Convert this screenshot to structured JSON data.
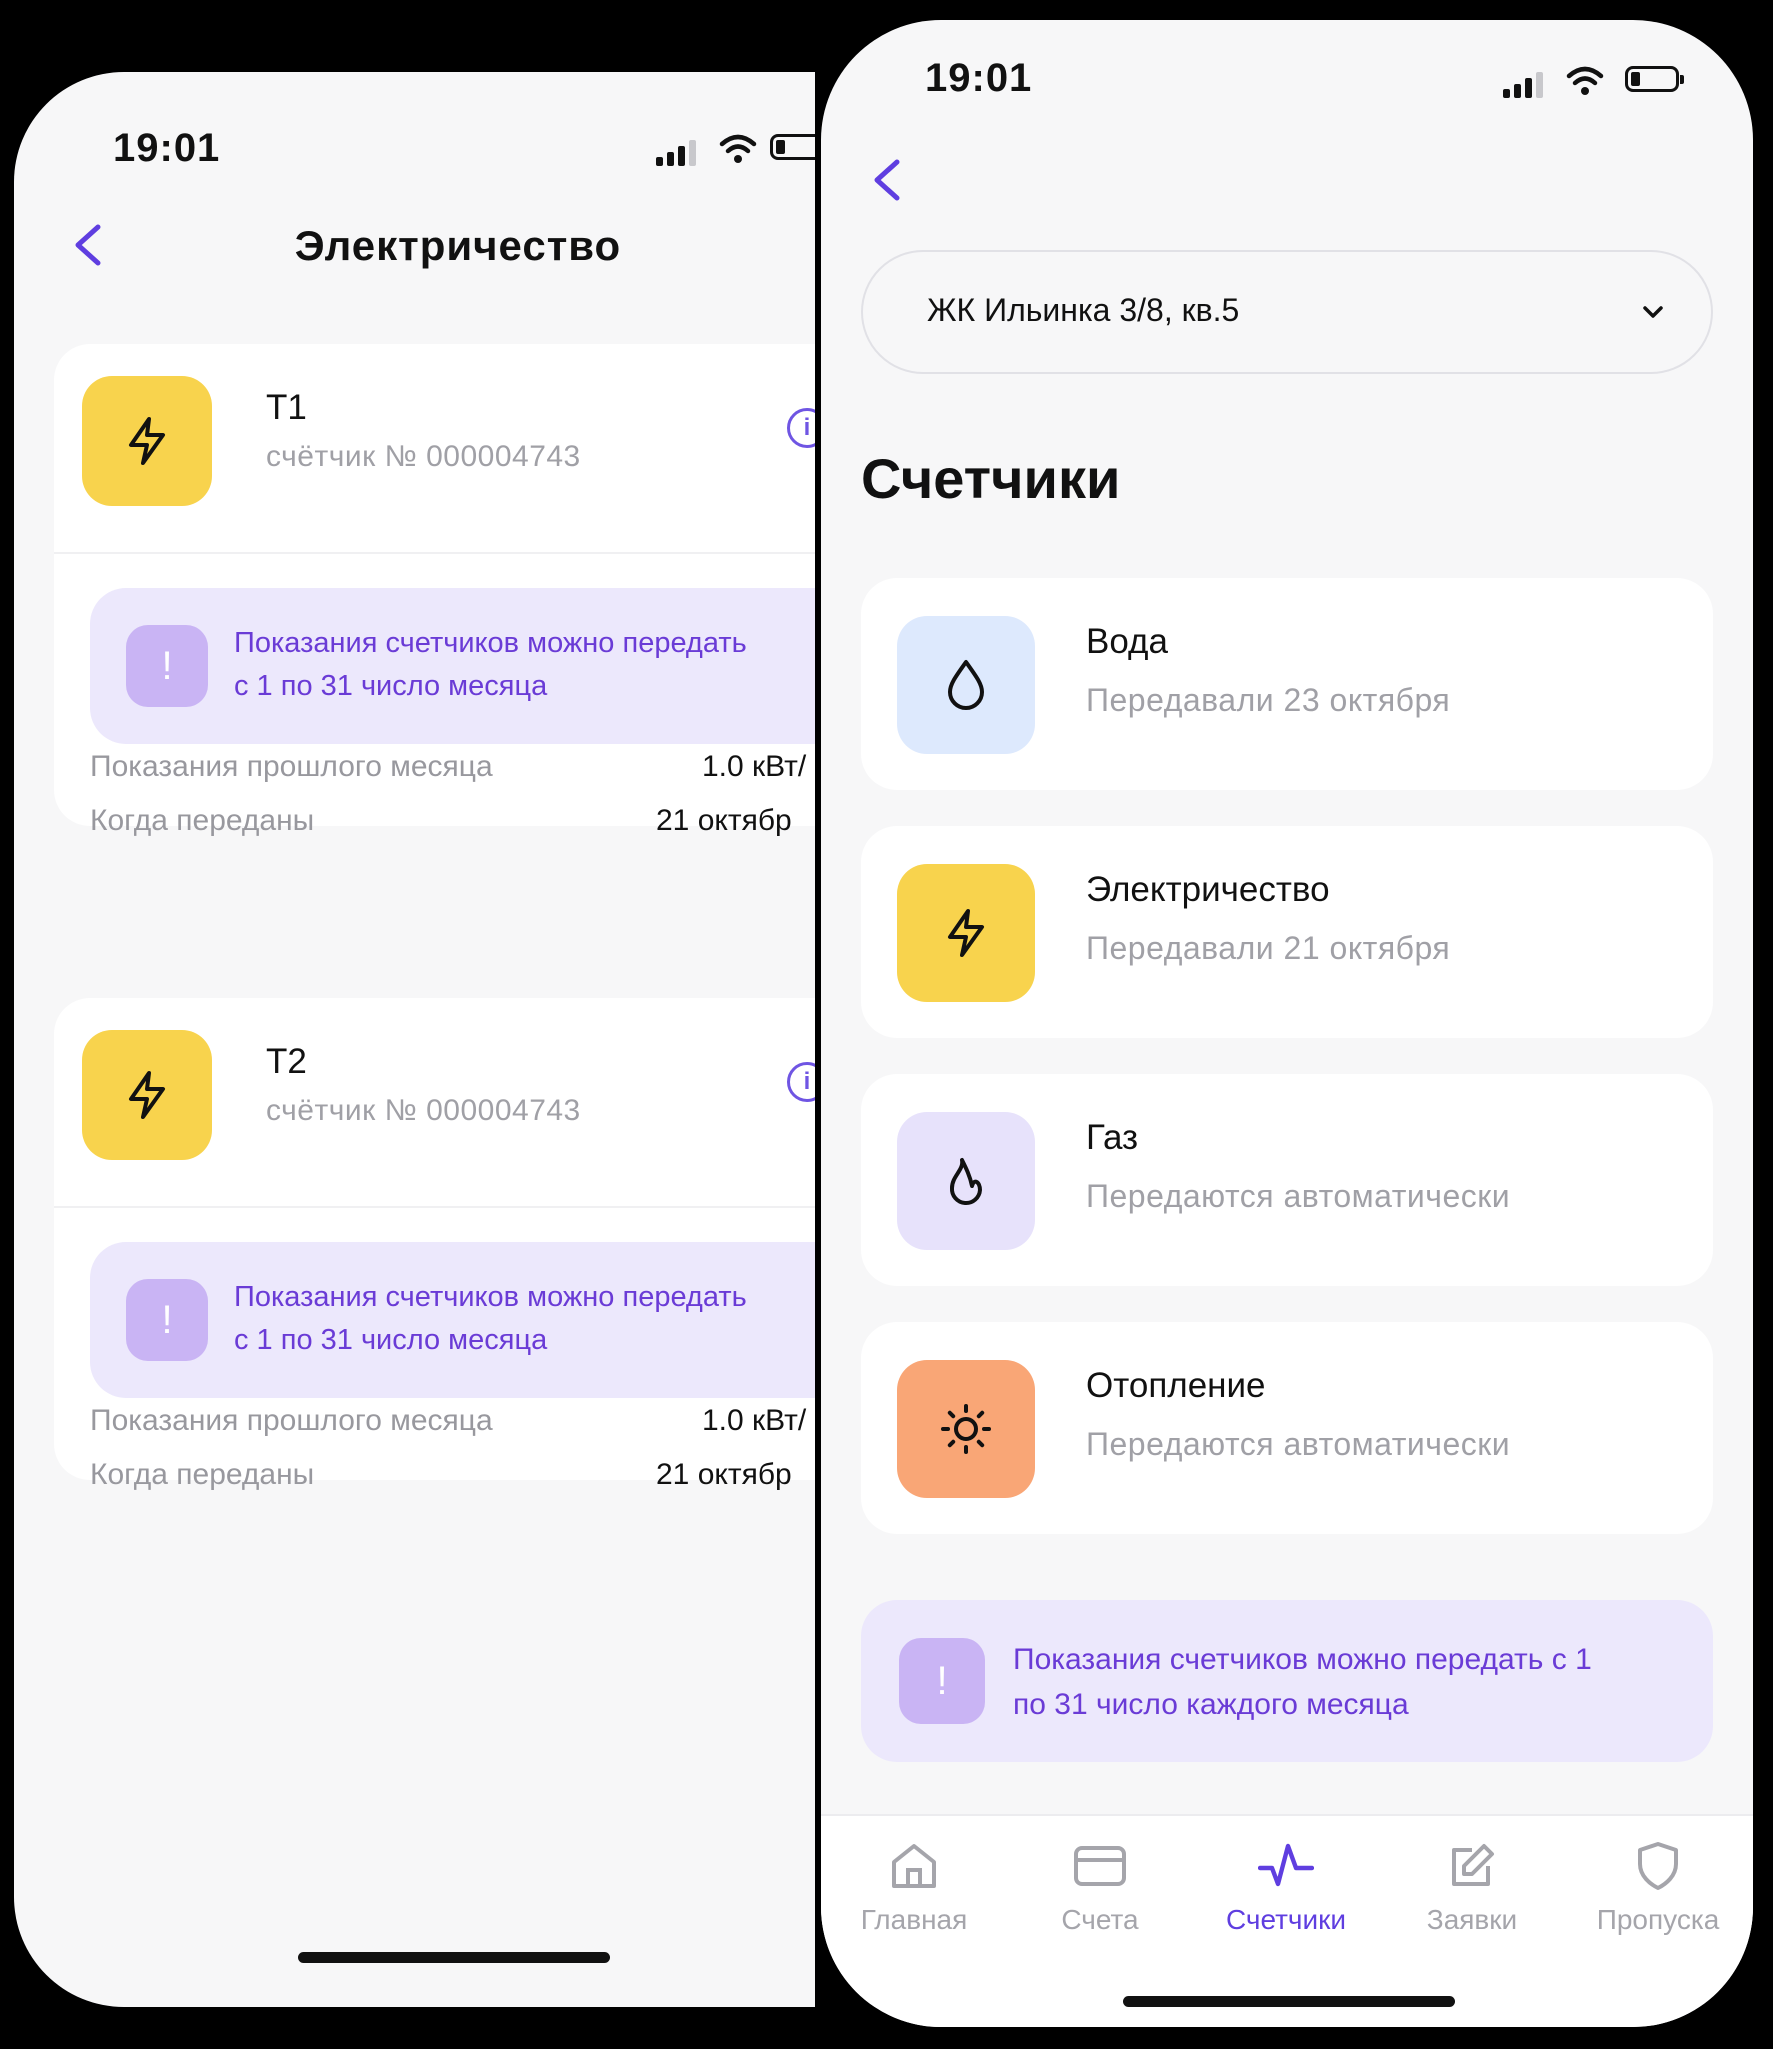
{
  "left_screen": {
    "status": {
      "time": "19:01"
    },
    "title": "Электричество",
    "meters": [
      {
        "name": "Т1",
        "number": "счётчик № 000004743",
        "notice": [
          "Показания счетчиков можно передать",
          "с 1 по 31 число месяца"
        ],
        "rows": [
          {
            "label": "Показания прошлого месяца",
            "value": "1.0 кВт/"
          },
          {
            "label": "Когда переданы",
            "value": "21 октябр"
          }
        ]
      },
      {
        "name": "Т2",
        "number": "счётчик № 000004743",
        "notice": [
          "Показания счетчиков можно передать",
          "с 1 по 31 число месяца"
        ],
        "rows": [
          {
            "label": "Показания прошлого месяца",
            "value": "1.0 кВт/"
          },
          {
            "label": "Когда переданы",
            "value": "21 октябр"
          }
        ]
      }
    ]
  },
  "right_screen": {
    "status": {
      "time": "19:01"
    },
    "address": "ЖК Ильинка 3/8, кв.5",
    "heading": "Счетчики",
    "meters": [
      {
        "name": "Вода",
        "subtitle": "Передавали 23 октября",
        "icon": "drop-icon",
        "color": "#dde9fd"
      },
      {
        "name": "Электричество",
        "subtitle": "Передавали 21 октября",
        "icon": "lightning-icon",
        "color": "#f8d34d"
      },
      {
        "name": "Газ",
        "subtitle": "Передаются автоматически",
        "icon": "flame-icon",
        "color": "#e7e2fb"
      },
      {
        "name": "Отопление",
        "subtitle": "Передаются автоматически",
        "icon": "sun-icon",
        "color": "#f9a676"
      }
    ],
    "notice": [
      "Показания счетчиков можно передать с 1",
      "по 31 число каждого месяца"
    ],
    "tabs": [
      {
        "label": "Главная",
        "icon": "home-icon",
        "active": false
      },
      {
        "label": "Счета",
        "icon": "card-icon",
        "active": false
      },
      {
        "label": "Счетчики",
        "icon": "pulse-icon",
        "active": true
      },
      {
        "label": "Заявки",
        "icon": "edit-icon",
        "active": false
      },
      {
        "label": "Пропуска",
        "icon": "shield-icon",
        "active": false
      }
    ]
  },
  "colors": {
    "accent": "#5f3ee0",
    "notice_bg": "#ece8fc",
    "notice_text": "#6a3bd6",
    "yellow": "#f8d34d",
    "orange": "#f9a676"
  }
}
